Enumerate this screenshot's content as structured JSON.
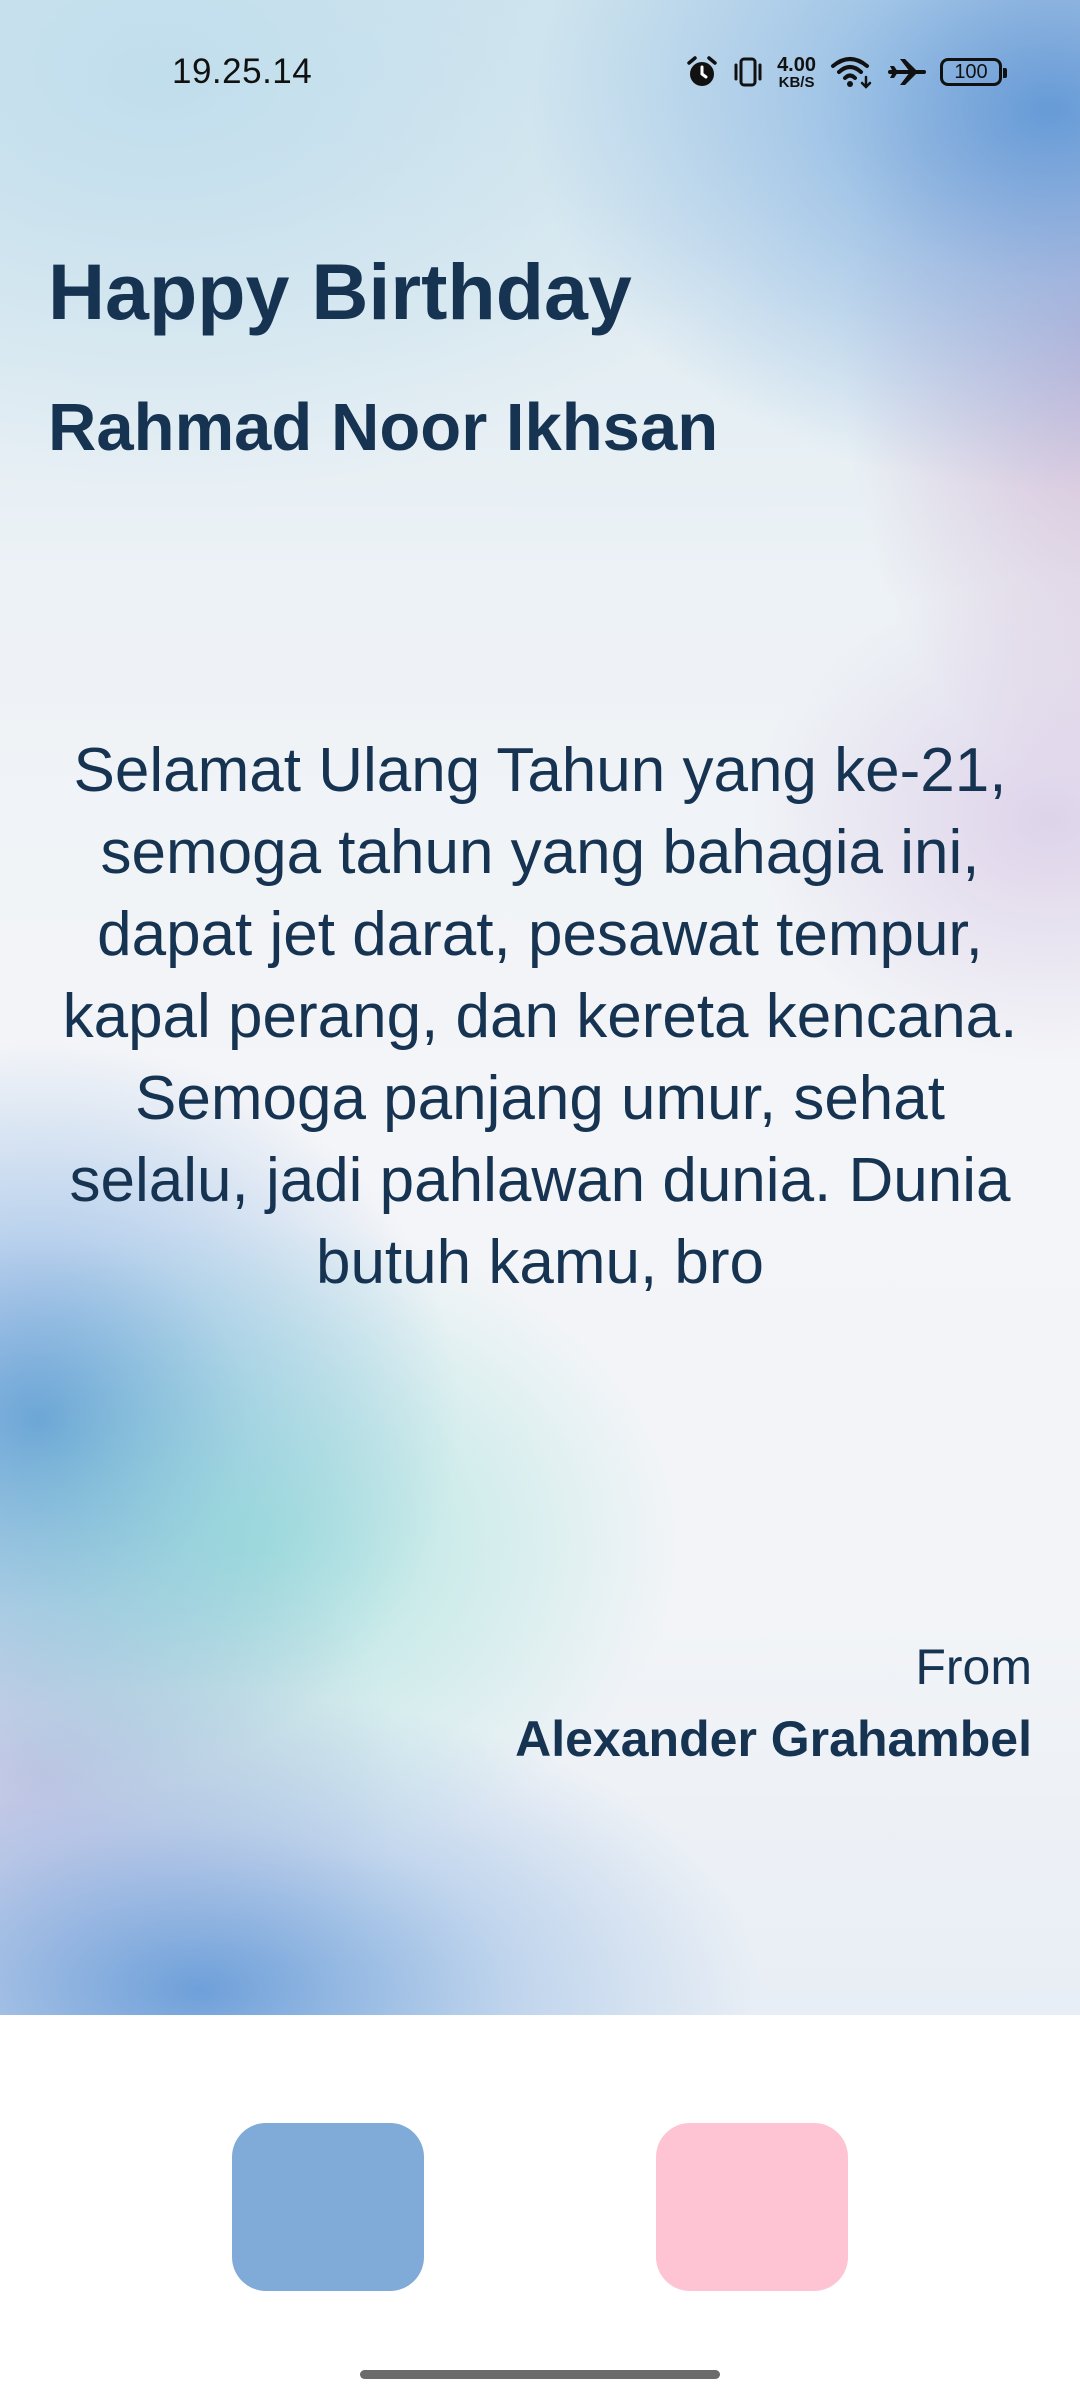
{
  "status_bar": {
    "time": "19.25.14",
    "net_speed_value": "4.00",
    "net_speed_unit": "KB/S",
    "battery": "100",
    "icons": [
      "alarm-icon",
      "vibrate-icon",
      "wifi-icon",
      "airplane-mode-icon",
      "battery-icon"
    ]
  },
  "card": {
    "title": "Happy Birthday",
    "recipient": "Rahmad Noor Ikhsan",
    "message": "Selamat Ulang Tahun yang ke-21, semoga tahun yang bahagia ini, dapat jet darat, pesawat tempur, kapal perang, dan kereta kencana. Semoga panjang umur, sehat selalu, jadi pahlawan dunia. Dunia butuh kamu, bro",
    "from_label": "From",
    "sender": "Alexander Grahambel"
  },
  "theme_buttons": [
    {
      "color": "#80abd9"
    },
    {
      "color": "#fec4d4"
    }
  ],
  "colors": {
    "text": "#163452",
    "blue_button": "#80abd9",
    "pink_button": "#fec4d4"
  }
}
